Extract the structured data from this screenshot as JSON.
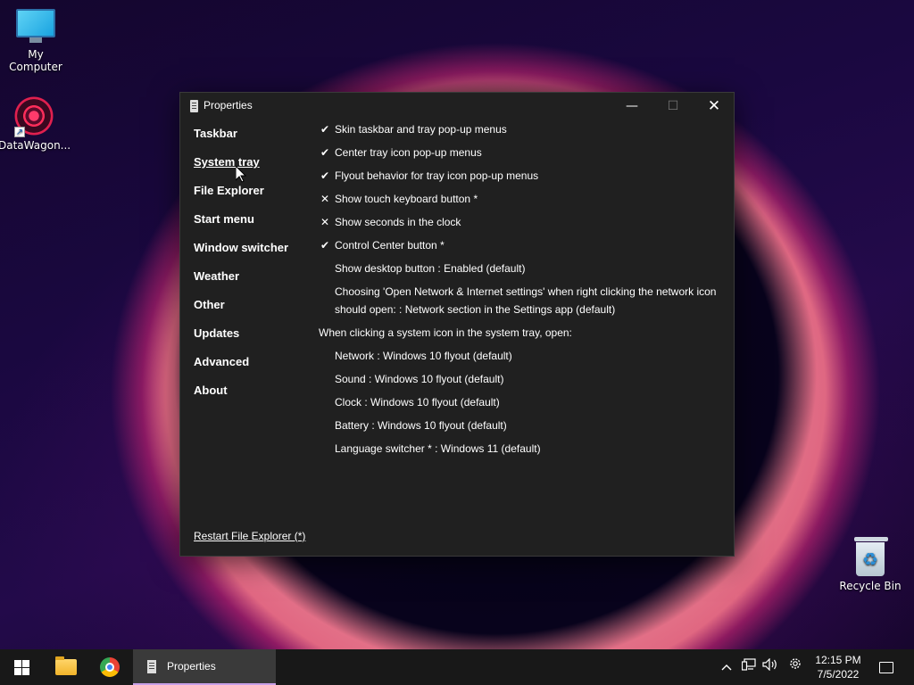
{
  "desktop": {
    "icons": [
      {
        "label": "My Computer"
      },
      {
        "label": "DataWagon..."
      },
      {
        "label": "Recycle Bin"
      }
    ]
  },
  "window": {
    "title": "Properties",
    "controls": {
      "minimize": "—",
      "maximize": "☐",
      "close": "✕"
    },
    "nav": [
      {
        "label": "Taskbar"
      },
      {
        "label": "System tray",
        "active": true
      },
      {
        "label": "File Explorer"
      },
      {
        "label": "Start menu"
      },
      {
        "label": "Window switcher"
      },
      {
        "label": "Weather"
      },
      {
        "label": "Other"
      },
      {
        "label": "Updates"
      },
      {
        "label": "Advanced"
      },
      {
        "label": "About"
      }
    ],
    "options": [
      {
        "mark": "✔",
        "label": "Skin taskbar and tray pop-up menus"
      },
      {
        "mark": "✔",
        "label": "Center tray icon pop-up menus"
      },
      {
        "mark": "✔",
        "label": "Flyout behavior for tray icon pop-up menus"
      },
      {
        "mark": "✕",
        "label": "Show touch keyboard button *"
      },
      {
        "mark": "✕",
        "label": "Show seconds in the clock"
      },
      {
        "mark": "✔",
        "label": "Control Center button *"
      },
      {
        "mark": "",
        "label": "Show desktop button : Enabled (default)"
      },
      {
        "mark": "",
        "label": "Choosing 'Open Network & Internet settings' when right clicking the network icon should open: : Network section in the Settings app (default)"
      }
    ],
    "tray_heading": "When clicking a system icon in the system tray, open:",
    "tray_options": [
      {
        "label": "Network : Windows 10 flyout (default)"
      },
      {
        "label": "Sound : Windows 10 flyout (default)"
      },
      {
        "label": "Clock : Windows 10 flyout (default)"
      },
      {
        "label": "Battery : Windows 10 flyout (default)"
      },
      {
        "label": "Language switcher * : Windows 11 (default)"
      }
    ],
    "restart_link": "Restart File Explorer (*)"
  },
  "taskbar": {
    "active_task": "Properties",
    "tray_icons": [
      "chevron-up-icon",
      "network-icon",
      "volume-icon",
      "settings-gear-icon"
    ],
    "clock": {
      "time": "12:15 PM",
      "date": "7/5/2022"
    }
  }
}
